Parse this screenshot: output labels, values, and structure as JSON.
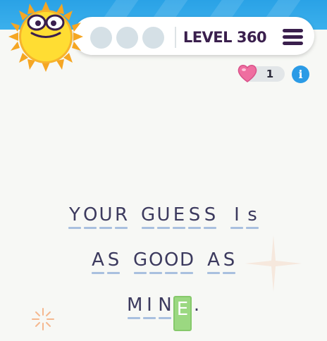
{
  "header": {
    "level_label": "LEVEL 360",
    "progress_dots": [
      false,
      false,
      false
    ]
  },
  "hints": {
    "count": "1"
  },
  "puzzle": {
    "lines": [
      [
        "YOUR",
        "GUESS",
        "Is"
      ],
      [
        "AS",
        "GOOD",
        "AS"
      ],
      [
        "MINE."
      ]
    ],
    "selected_letter": "E"
  },
  "colors": {
    "sky": "#2aa2e6",
    "text": "#3c3a5e",
    "underline": "#a9c0df",
    "selected": "#9bd881",
    "level_text": "#3a1f4d",
    "info_button": "#2b9be6"
  }
}
